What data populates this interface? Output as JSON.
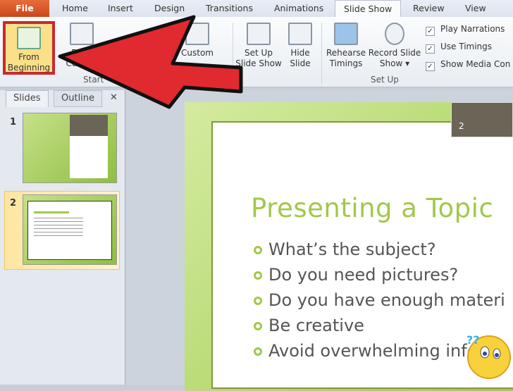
{
  "tabs": {
    "file": "File",
    "items": [
      "Home",
      "Insert",
      "Design",
      "Transitions",
      "Animations",
      "Slide Show",
      "Review",
      "View"
    ],
    "active": "Slide Show"
  },
  "ribbon": {
    "from_beginning": "From Beginning",
    "from_current": "From Current",
    "custom": "Custom",
    "start_group": "Start",
    "set_up_show": "Set Up Slide Show",
    "hide_slide": "Hide Slide",
    "rehearse": "Rehearse Timings",
    "record": "Record Slide Show ▾",
    "setup_group": "Set Up",
    "checks": [
      {
        "label": "Play Narrations",
        "checked": true
      },
      {
        "label": "Use Timings",
        "checked": true
      },
      {
        "label": "Show Media Con",
        "checked": true
      }
    ]
  },
  "pane": {
    "tab_slides": "Slides",
    "tab_outline": "Outline",
    "close": "✕",
    "slides": [
      {
        "number": "1"
      },
      {
        "number": "2",
        "selected": true
      }
    ]
  },
  "slide": {
    "number": "2",
    "title": "Presenting a Topic",
    "bullets": [
      "What’s the subject?",
      "Do you need pictures?",
      "Do you have enough materi",
      "Be creative",
      "Avoid overwhelming info"
    ]
  },
  "colors": {
    "accent": "#a2c84a",
    "arrow": "#e02a2f",
    "highlight": "#c8292e"
  }
}
